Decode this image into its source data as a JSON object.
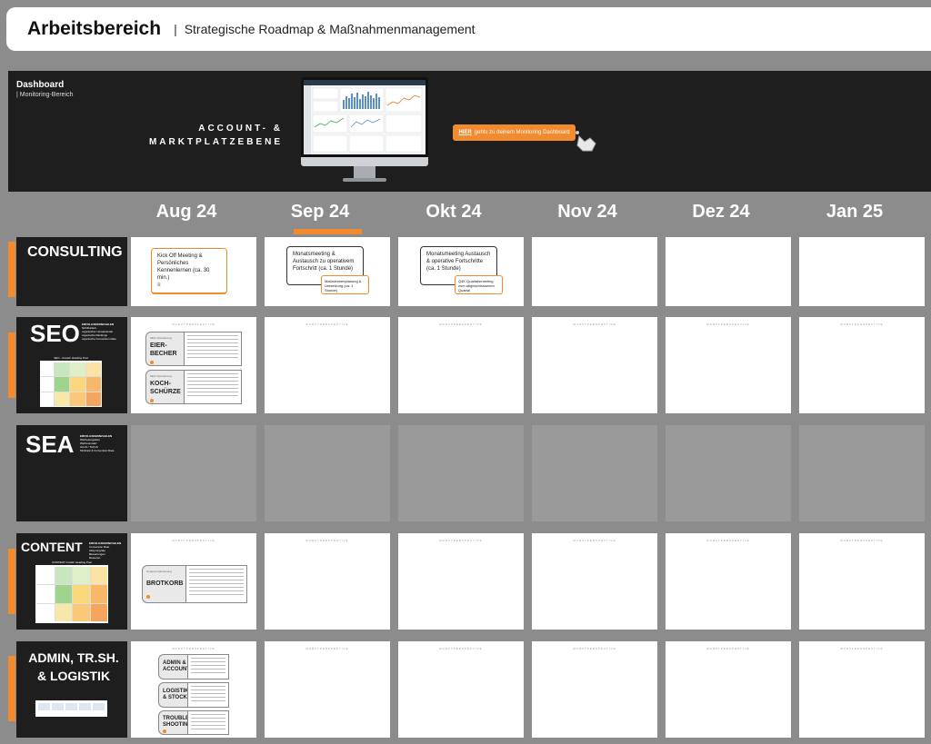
{
  "header": {
    "title": "Arbeitsbereich",
    "separator": "|",
    "subtitle": "Strategische Roadmap & Maßnahmenmanagement"
  },
  "banner": {
    "title": "Dashboard",
    "subtitle": "| Monitoring-Bereich",
    "level_line1": "ACCOUNT- &",
    "level_line2": "MARKTPLATZEBENE",
    "button_highlight": "HIER",
    "button_text": "gehts zu deinem Monitoring Dashboard"
  },
  "months": [
    "Aug 24",
    "Sep 24",
    "Okt 24",
    "Nov 24",
    "Dez 24",
    "Jan 25"
  ],
  "active_month_index": 1,
  "watermark": "MARKTPERSPEKTIVE",
  "rows": {
    "consulting": {
      "label": "CONSULTING",
      "cards": {
        "aug": "Kick Off Meeting & Persönliches Kennenlernen (ca. 30 min.)",
        "sep_main": "Monatsmeeting & Austausch zu operativem Fortschritt (ca. 1 Stunde)",
        "sep_sub": "Maßnahmenplanung & Umsetzung (ca. 1 Stunde)",
        "okt_main": "Monatsmeeting Austausch & operative Fortschritte (ca. 1 Stunde)",
        "okt_sub": "Q4K Quartalsmeeting zum abgeschlossenen Quartal"
      }
    },
    "seo": {
      "label": "SEO",
      "side_heading": "ERFOLGSKENNZAHLEN",
      "side_items": [
        "Sichtbarkeit",
        "organischer Umsatzanteil",
        "organische Rankings",
        "organische Conversion Rate"
      ],
      "matrix_title": "SEO - Growth Heading Post",
      "products": [
        {
          "line1": "EIER-",
          "line2": "BECHER",
          "meta": "SEO-Optimierung"
        },
        {
          "line1": "KOCH-",
          "line2": "SCHÜRZE",
          "meta": "SEO-Optimierung"
        }
      ]
    },
    "sea": {
      "label": "SEA",
      "side_heading": "ERFOLGSKENNZAHLEN",
      "side_items": [
        "Werbeausgaben",
        "Werbeumsatz",
        "ACoS / TACoS",
        "Klickrate & Conversion Rate"
      ]
    },
    "content": {
      "label": "CONTENT",
      "side_heading": "ERFOLGSKENNZAHLEN",
      "side_items": [
        "Conversion Rate",
        "Absprungrate",
        "Bewertungen",
        "Retouren"
      ],
      "matrix_title": "CONTENT Growth Heading Post",
      "products": [
        {
          "line1": "BROTKORB",
          "line2": "",
          "meta": "Content-Optimierung"
        }
      ]
    },
    "admin": {
      "label_line1": "ADMIN, TR.SH.",
      "label_line2": "& LOGISTIK",
      "products": [
        {
          "line1": "ADMIN &",
          "line2": "ACCOUNT"
        },
        {
          "line1": "LOGISTIK",
          "line2": "& STOCK"
        },
        {
          "line1": "TROUBLE-",
          "line2": "SHOOTING"
        }
      ]
    }
  },
  "colors": {
    "accent": "#f28a2e",
    "dark_panel": "#1e1e1e",
    "background": "#8c8c8c",
    "sea_cell": "#9a9a9a"
  }
}
